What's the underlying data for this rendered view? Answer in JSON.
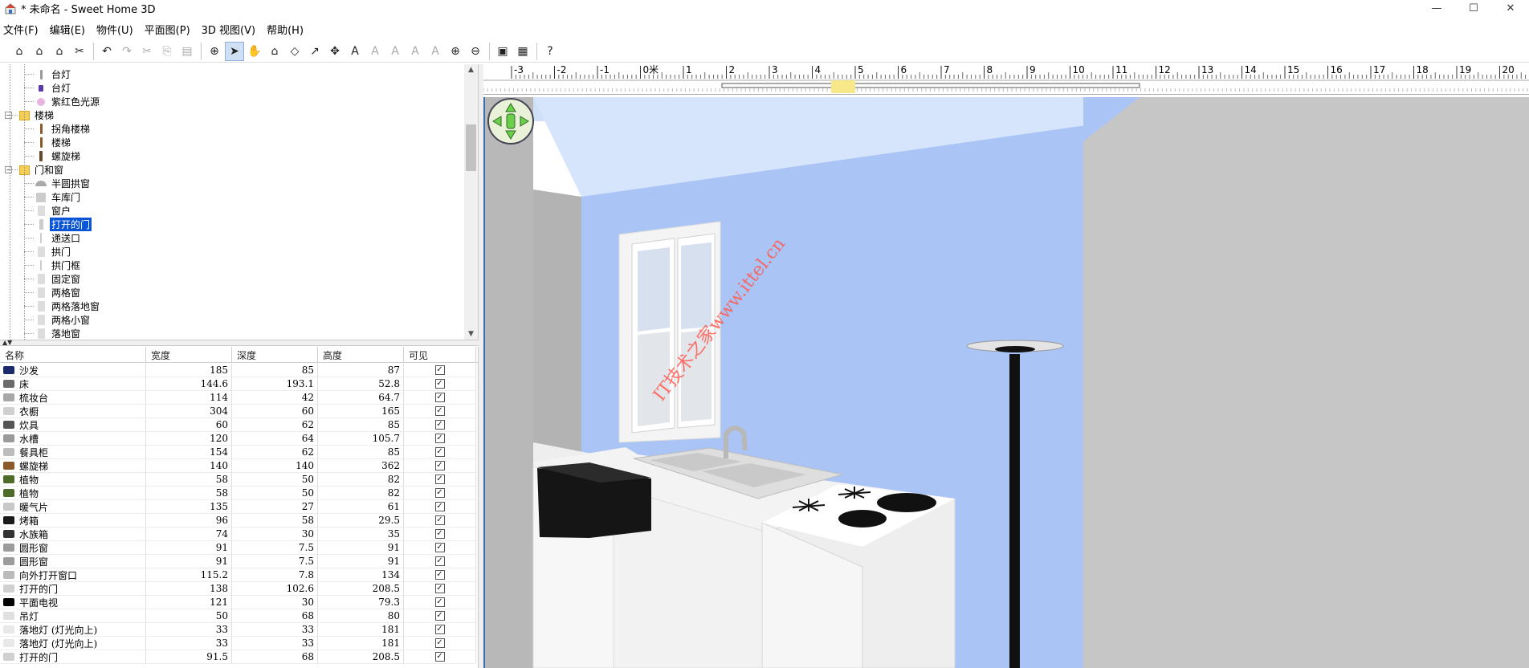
{
  "window": {
    "title": "* 未命名 - Sweet Home 3D",
    "controls": [
      "minimize-icon",
      "maximize-icon",
      "close-icon"
    ]
  },
  "menu": [
    "文件(F)",
    "编辑(E)",
    "物件(U)",
    "平面图(P)",
    "3D 视图(V)",
    "帮助(H)"
  ],
  "toolbar": {
    "buttons": [
      {
        "name": "new-home-icon",
        "glyph": "⌂"
      },
      {
        "name": "open-icon",
        "glyph": "⌂"
      },
      {
        "name": "save-icon",
        "glyph": "⌂"
      },
      {
        "name": "preferences-icon",
        "glyph": "✂"
      },
      {
        "sep": true
      },
      {
        "name": "undo-icon",
        "glyph": "↶"
      },
      {
        "name": "redo-icon",
        "glyph": "↷",
        "disabled": true
      },
      {
        "name": "cut-icon",
        "glyph": "✂",
        "disabled": true
      },
      {
        "name": "copy-icon",
        "glyph": "⎘",
        "disabled": true
      },
      {
        "name": "paste-icon",
        "glyph": "▤",
        "disabled": true
      },
      {
        "sep": true
      },
      {
        "name": "add-furniture-icon",
        "glyph": "⊕"
      },
      {
        "name": "select-mode-icon",
        "glyph": "➤",
        "selected": true
      },
      {
        "name": "pan-mode-icon",
        "glyph": "✋"
      },
      {
        "name": "create-walls-icon",
        "glyph": "⌂"
      },
      {
        "name": "create-rooms-icon",
        "glyph": "◇"
      },
      {
        "name": "create-polylines-icon",
        "glyph": "↗"
      },
      {
        "name": "create-dimensions-icon",
        "glyph": "✥"
      },
      {
        "name": "add-text-icon",
        "glyph": "A"
      },
      {
        "name": "increase-text-icon",
        "glyph": "A",
        "disabled": true
      },
      {
        "name": "decrease-text-icon",
        "glyph": "A",
        "disabled": true
      },
      {
        "name": "bold-text-icon",
        "glyph": "A",
        "disabled": true
      },
      {
        "name": "italic-text-icon",
        "glyph": "A",
        "disabled": true
      },
      {
        "name": "zoom-in-icon",
        "glyph": "⊕"
      },
      {
        "name": "zoom-out-icon",
        "glyph": "⊖"
      },
      {
        "sep": true
      },
      {
        "name": "create-photo-icon",
        "glyph": "▣"
      },
      {
        "name": "create-video-icon",
        "glyph": "▦"
      },
      {
        "sep": true
      },
      {
        "name": "help-icon",
        "glyph": "?"
      }
    ]
  },
  "catalog": {
    "items": [
      {
        "level": 2,
        "label": "台灯",
        "icon": "lamp"
      },
      {
        "level": 2,
        "label": "台灯",
        "icon": "lamp-purple"
      },
      {
        "level": 2,
        "label": "紫红色光源",
        "icon": "bulb"
      },
      {
        "level": 1,
        "label": "楼梯",
        "icon": "folder",
        "expanded": true
      },
      {
        "level": 2,
        "label": "拐角楼梯",
        "icon": "stair"
      },
      {
        "level": 2,
        "label": "楼梯",
        "icon": "stair"
      },
      {
        "level": 2,
        "label": "螺旋梯",
        "icon": "spiral"
      },
      {
        "level": 1,
        "label": "门和窗",
        "icon": "folder",
        "expanded": true
      },
      {
        "level": 2,
        "label": "半圆拱窗",
        "icon": "arch"
      },
      {
        "level": 2,
        "label": "车库门",
        "icon": "door"
      },
      {
        "level": 2,
        "label": "窗户",
        "icon": "window"
      },
      {
        "level": 2,
        "label": "打开的门",
        "icon": "door-open",
        "selected": true
      },
      {
        "level": 2,
        "label": "递送口",
        "icon": "slot"
      },
      {
        "level": 2,
        "label": "拱门",
        "icon": "window"
      },
      {
        "level": 2,
        "label": "拱门框",
        "icon": "slot"
      },
      {
        "level": 2,
        "label": "固定窗",
        "icon": "window"
      },
      {
        "level": 2,
        "label": "两格窗",
        "icon": "window"
      },
      {
        "level": 2,
        "label": "两格落地窗",
        "icon": "window"
      },
      {
        "level": 2,
        "label": "两格小窗",
        "icon": "window"
      },
      {
        "level": 2,
        "label": "落地窗",
        "icon": "window"
      }
    ]
  },
  "furniture_table": {
    "columns": [
      "名称",
      "宽度",
      "深度",
      "高度",
      "可见"
    ],
    "rows": [
      {
        "name": "沙发",
        "w": "185",
        "d": "85",
        "h": "87",
        "color": "#1b2a6b"
      },
      {
        "name": "床",
        "w": "144.6",
        "d": "193.1",
        "h": "52.8",
        "color": "#6b6b6b"
      },
      {
        "name": "梳妆台",
        "w": "114",
        "d": "42",
        "h": "64.7",
        "color": "#a8a8a8"
      },
      {
        "name": "衣橱",
        "w": "304",
        "d": "60",
        "h": "165",
        "color": "#cfcfcf"
      },
      {
        "name": "炊具",
        "w": "60",
        "d": "62",
        "h": "85",
        "color": "#555555"
      },
      {
        "name": "水槽",
        "w": "120",
        "d": "64",
        "h": "105.7",
        "color": "#9a9a9a"
      },
      {
        "name": "餐具柜",
        "w": "154",
        "d": "62",
        "h": "85",
        "color": "#bdbdbd"
      },
      {
        "name": "螺旋梯",
        "w": "140",
        "d": "140",
        "h": "362",
        "color": "#8a5a2b"
      },
      {
        "name": "植物",
        "w": "58",
        "d": "50",
        "h": "82",
        "color": "#4f6b2a"
      },
      {
        "name": "植物",
        "w": "58",
        "d": "50",
        "h": "82",
        "color": "#4f6b2a"
      },
      {
        "name": "暖气片",
        "w": "135",
        "d": "27",
        "h": "61",
        "color": "#c8c8c8"
      },
      {
        "name": "烤箱",
        "w": "96",
        "d": "58",
        "h": "29.5",
        "color": "#1a1a1a"
      },
      {
        "name": "水族箱",
        "w": "74",
        "d": "30",
        "h": "35",
        "color": "#333333"
      },
      {
        "name": "圆形窗",
        "w": "91",
        "d": "7.5",
        "h": "91",
        "color": "#9c9c9c"
      },
      {
        "name": "圆形窗",
        "w": "91",
        "d": "7.5",
        "h": "91",
        "color": "#9c9c9c"
      },
      {
        "name": "向外打开窗口",
        "w": "115.2",
        "d": "7.8",
        "h": "134",
        "color": "#bbbbbb"
      },
      {
        "name": "打开的门",
        "w": "138",
        "d": "102.6",
        "h": "208.5",
        "color": "#d0d0d0"
      },
      {
        "name": "平面电视",
        "w": "121",
        "d": "30",
        "h": "79.3",
        "color": "#000000"
      },
      {
        "name": "吊灯",
        "w": "50",
        "d": "68",
        "h": "80",
        "color": "#e0e0e0"
      },
      {
        "name": "落地灯 (灯光向上)",
        "w": "33",
        "d": "33",
        "h": "181",
        "color": "#e8e8e8"
      },
      {
        "name": "落地灯 (灯光向上)",
        "w": "33",
        "d": "33",
        "h": "181",
        "color": "#e8e8e8"
      },
      {
        "name": "打开的门",
        "w": "91.5",
        "d": "68",
        "h": "208.5",
        "color": "#d0d0d0"
      }
    ]
  },
  "ruler": {
    "labels": [
      "-3",
      "-2",
      "-1",
      "0米",
      "1",
      "2",
      "3",
      "4",
      "5",
      "6",
      "7",
      "8",
      "9",
      "10",
      "11",
      "12",
      "13",
      "14",
      "15",
      "16",
      "17",
      "18",
      "19",
      "20"
    ]
  },
  "view3d": {
    "watermark": "IT技术之家www.ittel.cn",
    "navigator": "navigation-arrows-icon",
    "colors": {
      "ceiling": "#cfe0f8",
      "back_wall": "#a9c4f5",
      "side_wall": "#c6c6c6",
      "left_wall": "#b3b3b3"
    }
  }
}
